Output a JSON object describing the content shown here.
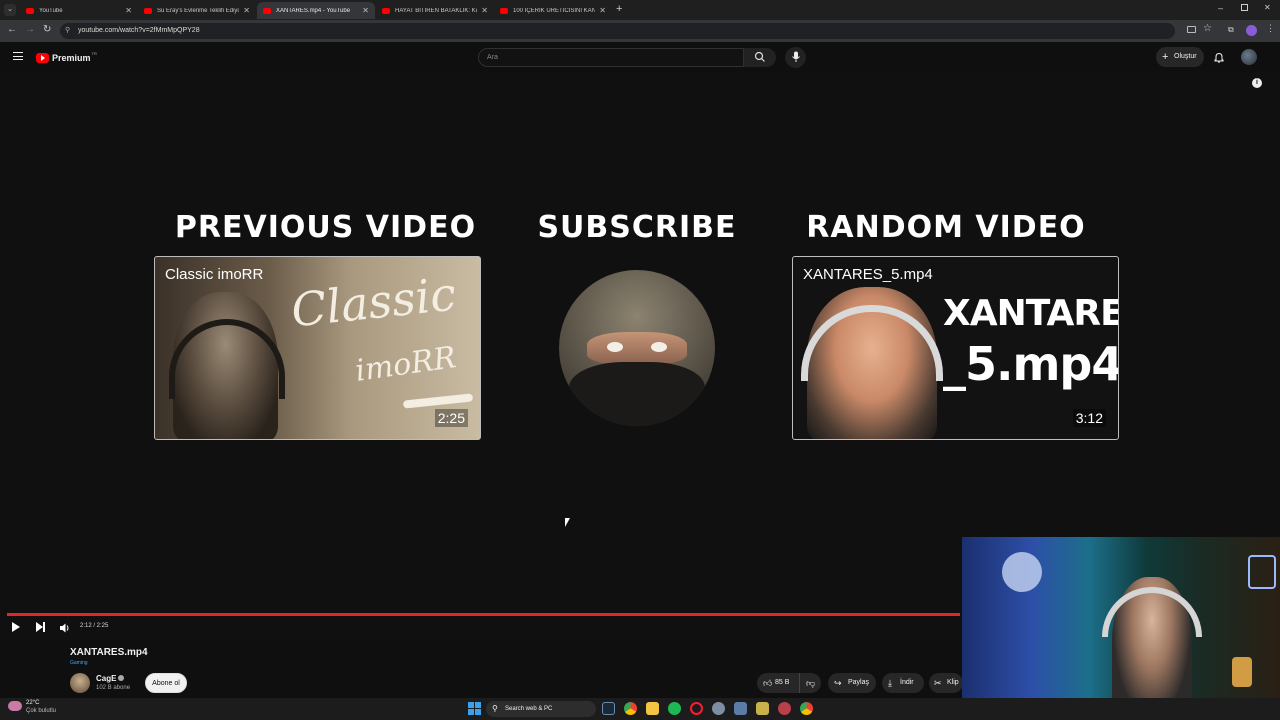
{
  "browser": {
    "tabs": [
      {
        "title": "YouTube",
        "active": false
      },
      {
        "title": "Su Eray's Evlenme Teklifi Ediyor",
        "active": false
      },
      {
        "title": "XANTARES.mp4 - YouTube",
        "active": true
      },
      {
        "title": "HAYAT BİTİREN BATAKLIK: Kuru",
        "active": false
      },
      {
        "title": "100 İÇERİK ÜRETİCİSİNİ KANDIR",
        "active": false
      }
    ],
    "url": "youtube.com/watch?v=2fMmMpQPY28"
  },
  "youtube": {
    "logo_text": "Premium",
    "logo_sup": "TR",
    "search_placeholder": "Ara",
    "create_label": "Oluştur"
  },
  "endscreen": {
    "previous_heading": "PREVIOUS VIDEO",
    "subscribe_heading": "SUBSCRIBE",
    "random_heading": "RANDOM VIDEO",
    "previous_card": {
      "title": "Classic imoRR",
      "art_line1": "Classic",
      "art_line2": "imoRR",
      "duration": "2:25"
    },
    "random_card": {
      "title": "XANTARES_5.mp4",
      "art_line1": "XANTARES",
      "art_line2": "_5.mp4",
      "duration": "3:12"
    }
  },
  "player": {
    "time": "2:12 / 2:25",
    "progress_fraction": 1.0
  },
  "video_info": {
    "title": "XANTARES.mp4",
    "badge": "Gaming",
    "channel": "CagE",
    "subscribers": "102 B abone",
    "subscribe_label": "Abone ol",
    "likes": "85 B",
    "share_label": "Paylaş",
    "download_label": "İndir",
    "clip_label": "Klip"
  },
  "taskbar": {
    "weather_temp": "22°C",
    "weather_desc": "Çok bulutlu",
    "search_label": "Search web & PC"
  },
  "colors": {
    "youtube_red": "#ff0000",
    "progress": "#e5252a",
    "background": "#0f0f0f"
  }
}
